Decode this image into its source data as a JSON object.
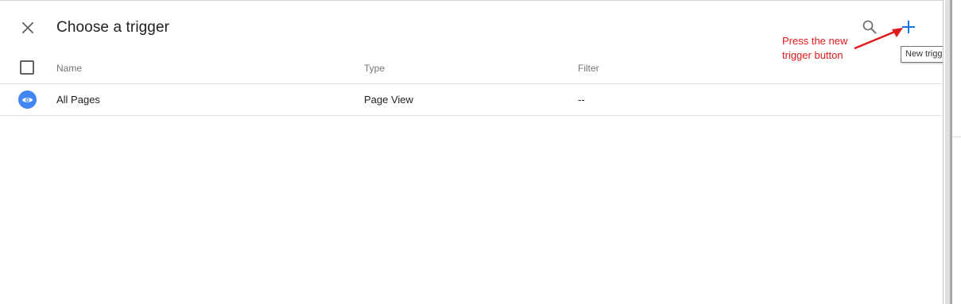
{
  "header": {
    "title": "Choose a trigger",
    "close_icon": "close-icon",
    "search_icon": "search-icon",
    "add_icon": "plus-icon",
    "add_tooltip": "New trigger"
  },
  "annotation": {
    "line1": "Press the new",
    "line2": "trigger button",
    "color": "#e0191c"
  },
  "table": {
    "columns": [
      "Name",
      "Type",
      "Filter"
    ],
    "rows": [
      {
        "icon": "eye-icon",
        "name": "All Pages",
        "type": "Page View",
        "filter": "--"
      }
    ]
  },
  "colors": {
    "accent": "#1a73e8",
    "trigger_icon_bg": "#4285f4",
    "text_primary": "#212121",
    "text_secondary": "#757575"
  }
}
